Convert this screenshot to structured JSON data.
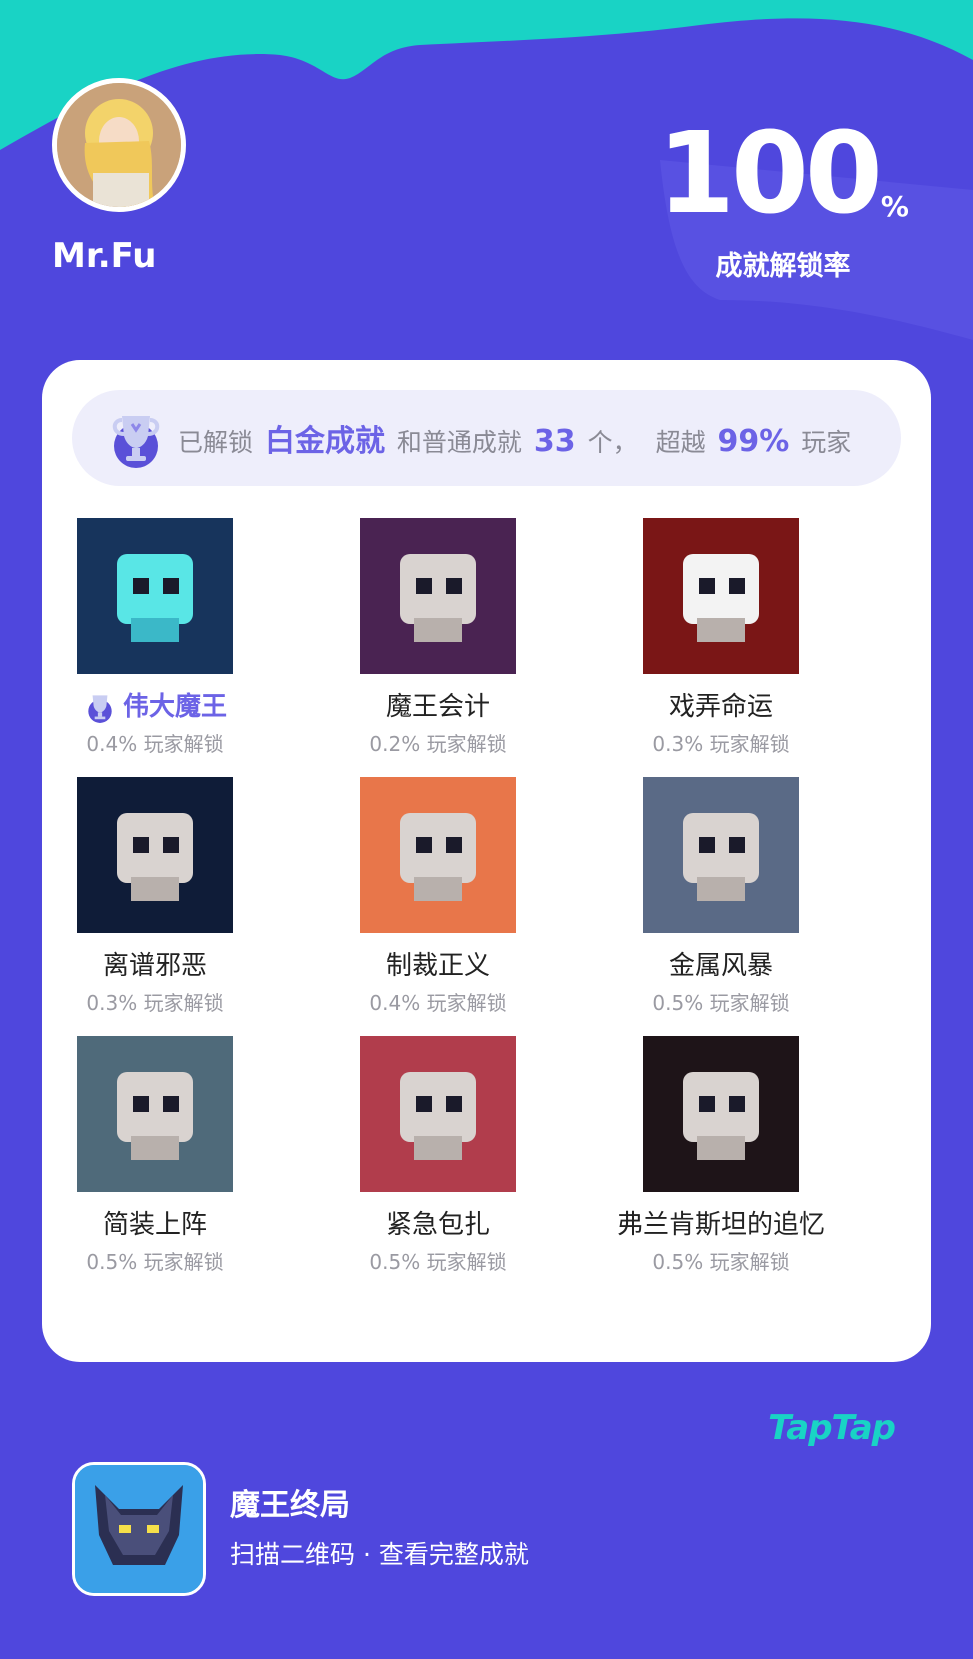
{
  "header": {
    "username": "Mr.Fu",
    "percent": "100",
    "percent_sign": "%",
    "percent_label": "成就解锁率"
  },
  "summary": {
    "prefix": "已解锁",
    "platinum": "白金成就",
    "middle": "和普通成就",
    "count": "33",
    "count_unit": "个，",
    "exceed": "超越",
    "exceed_pct": "99%",
    "suffix": "玩家"
  },
  "achievements": [
    {
      "name": "伟大魔王",
      "rate": "0.4% 玩家解锁",
      "platinum": true,
      "icon": "skull-burst-icon",
      "bg": "#17345c"
    },
    {
      "name": "魔王会计",
      "rate": "0.2% 玩家解锁",
      "platinum": false,
      "icon": "accountant-demon-icon",
      "bg": "#4a2352"
    },
    {
      "name": "戏弄命运",
      "rate": "0.3% 玩家解锁",
      "platinum": false,
      "icon": "cards-icon",
      "bg": "#7a1616"
    },
    {
      "name": "离谱邪恶",
      "rate": "0.3% 玩家解锁",
      "platinum": false,
      "icon": "evil-demon-icon",
      "bg": "#0f1c38"
    },
    {
      "name": "制裁正义",
      "rate": "0.4% 玩家解锁",
      "platinum": false,
      "icon": "bonk-icon",
      "bg": "#e8764a"
    },
    {
      "name": "金属风暴",
      "rate": "0.5% 玩家解锁",
      "platinum": false,
      "icon": "metal-storm-icon",
      "bg": "#5a6a86"
    },
    {
      "name": "简装上阵",
      "rate": "0.5% 玩家解锁",
      "platinum": false,
      "icon": "question-bubble-icon",
      "bg": "#4f6a7a"
    },
    {
      "name": "紧急包扎",
      "rate": "0.5% 玩家解锁",
      "platinum": false,
      "icon": "mummy-icon",
      "bg": "#b13d4c"
    },
    {
      "name": "弗兰肯斯坦的追忆",
      "rate": "0.5% 玩家解锁",
      "platinum": false,
      "icon": "frankenstein-icon",
      "bg": "#1e1418"
    }
  ],
  "branding": {
    "taptap": "TapTap",
    "game_name": "魔王终局",
    "game_sub": "扫描二维码 · 查看完整成就"
  },
  "colors": {
    "background": "#4f47dd",
    "wave": "#19d3c5",
    "accent": "#6c63e6"
  }
}
